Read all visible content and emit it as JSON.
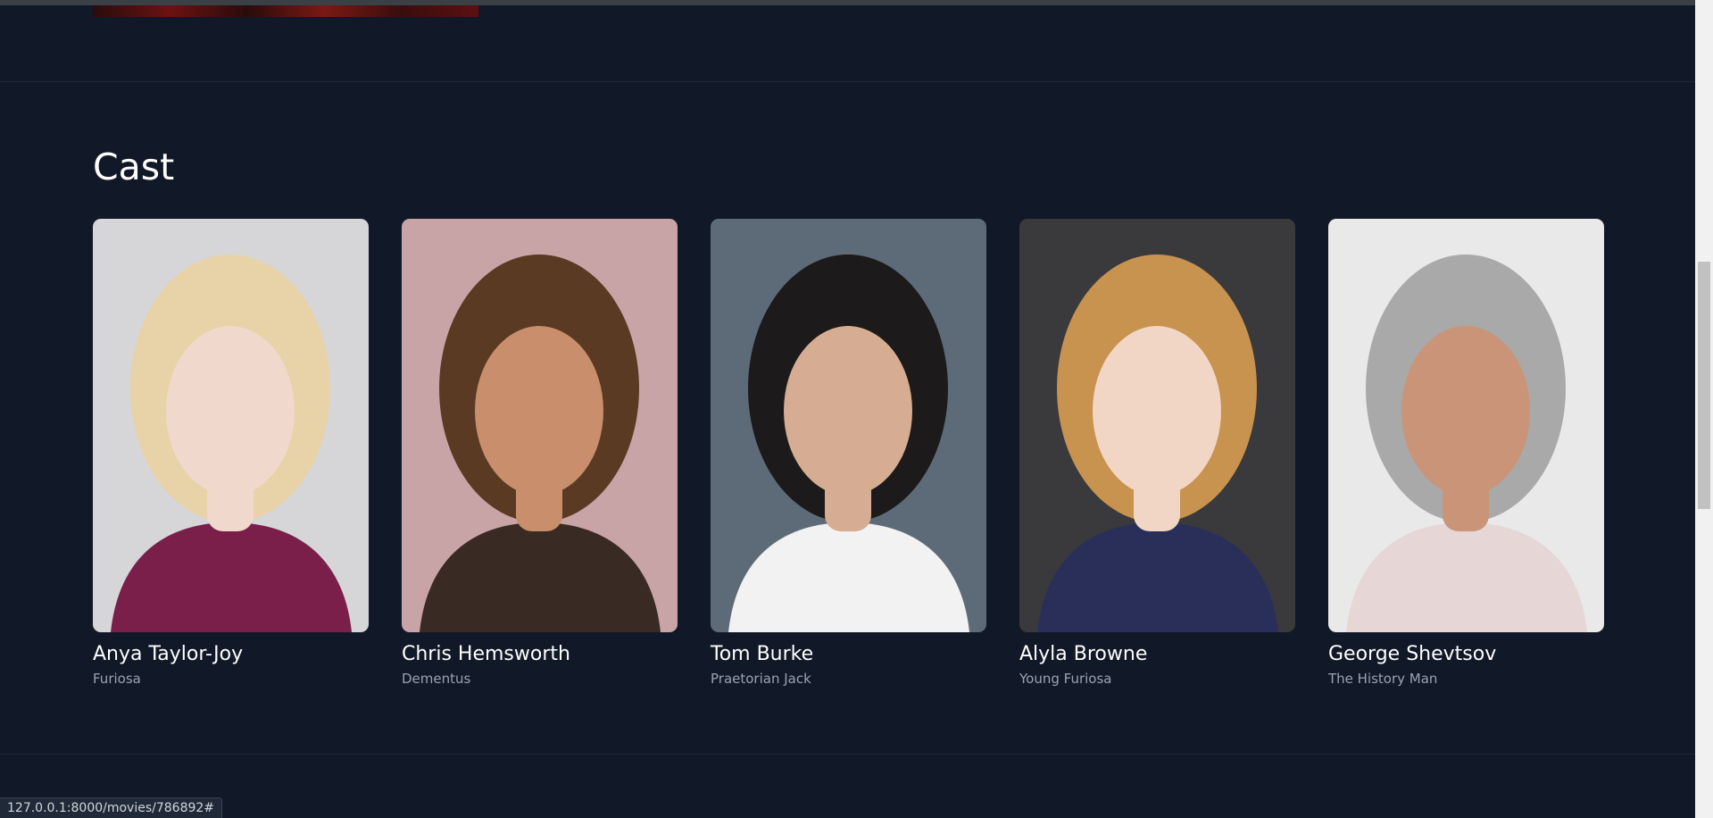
{
  "section": {
    "title": "Cast"
  },
  "cast": [
    {
      "name": "Anya Taylor-Joy",
      "role": "Furiosa",
      "bg": "#d6d6d8",
      "skin": "#f0d9cc",
      "hair": "#e8d2a8",
      "cloth": "#7a1e4a"
    },
    {
      "name": "Chris Hemsworth",
      "role": "Dementus",
      "bg": "#c9a4a6",
      "skin": "#c98f6c",
      "hair": "#5a3a22",
      "cloth": "#3a2a24"
    },
    {
      "name": "Tom Burke",
      "role": "Praetorian Jack",
      "bg": "#5d6b78",
      "skin": "#d6ad92",
      "hair": "#1c1a1a",
      "cloth": "#f2f2f2"
    },
    {
      "name": "Alyla Browne",
      "role": "Young Furiosa",
      "bg": "#3a3a3c",
      "skin": "#f1d6c6",
      "hair": "#c8924f",
      "cloth": "#2a2f5a"
    },
    {
      "name": "George Shevtsov",
      "role": "The History Man",
      "bg": "#e9e9e9",
      "skin": "#c99478",
      "hair": "#a9a9a9",
      "cloth": "#e6d6d6"
    }
  ],
  "status_bar": {
    "url": "127.0.0.1:8000/movies/786892#"
  }
}
